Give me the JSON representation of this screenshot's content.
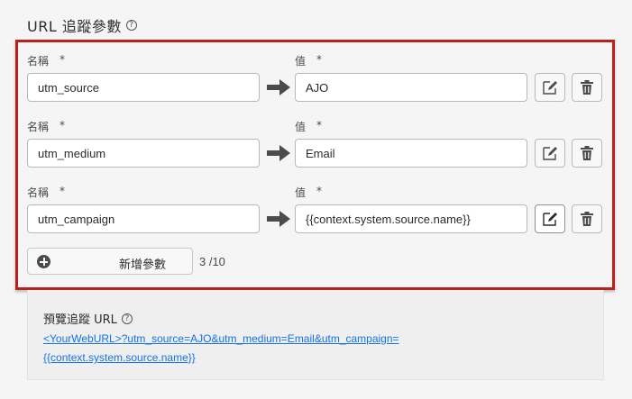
{
  "section": {
    "title": "URL 追蹤參數"
  },
  "params": [
    {
      "name_label": "名稱",
      "value_label": "值",
      "required": "*",
      "name": "utm_source",
      "value": "AJO"
    },
    {
      "name_label": "名稱",
      "value_label": "值",
      "required": "*",
      "name": "utm_medium",
      "value": "Email"
    },
    {
      "name_label": "名稱",
      "value_label": "值",
      "required": "*",
      "name": "utm_campaign",
      "value": "{{context.system.source.name}}"
    }
  ],
  "add_button": {
    "label": "新增參數"
  },
  "count": "3 /10",
  "preview": {
    "title": "預覽追蹤 URL",
    "url_line1": "<YourWebURL>?utm_source=AJO&utm_medium=Email&utm_campaign=",
    "url_line2": "{{context.system.source.name}}"
  },
  "icons": {
    "help": "help-circle-icon",
    "arrow": "arrow-right-icon",
    "edit": "edit-icon",
    "delete": "trash-icon",
    "add": "plus-circle-icon"
  },
  "colors": {
    "highlight_border": "#b7221e",
    "link": "#1473e6"
  }
}
